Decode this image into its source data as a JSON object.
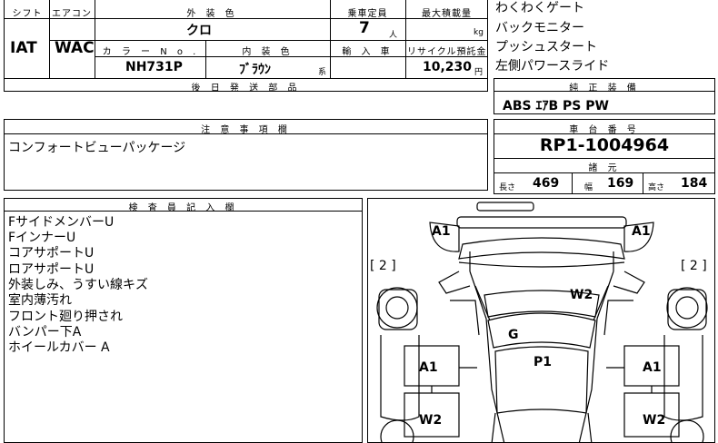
{
  "spec": {
    "shift_header": "シフト",
    "aircon_header": "エアコン",
    "shift": "IAT",
    "aircon": "WAC",
    "exterior_header": "外 装 色",
    "exterior": "クロ",
    "capacity_header": "乗車定員",
    "capacity": "7",
    "capacity_unit": "人",
    "loadcap_header": "最大積載量",
    "loadcap_unit": "kg",
    "colorno_header": "カ ラ ー N o .",
    "colorno": "NH731P",
    "interior_header": "内 装 色",
    "interior": "ﾌﾞﾗｳﾝ",
    "interior_suffix": "系",
    "import_header": "輸 入 車",
    "recycle_header": "リサイクル預託金",
    "recycle": "10,230",
    "recycle_unit": "円",
    "later_parts_header": "後 日 発 送 部 品"
  },
  "options": [
    "わくわくゲート",
    "バックモニター",
    "プッシュスタート",
    "左側パワースライド"
  ],
  "genuine": {
    "header": "純 正 装 備",
    "value": "ABS ｴｱB PS PW"
  },
  "caution": {
    "header": "注 意 事 項 欄",
    "text": "コンフォートビューパッケージ"
  },
  "chassis": {
    "header": "車 台 番 号",
    "value": "RP1-1004964"
  },
  "dims": {
    "header": "諸 元",
    "length_label": "長さ",
    "length": "469",
    "width_label": "幅",
    "width": "169",
    "height_label": "高さ",
    "height": "184"
  },
  "inspector": {
    "header": "検 査 員 記 入 欄",
    "lines": [
      "FサイドメンバーU",
      "FインナーU",
      "コアサポートU",
      "ロアサポートU",
      "外装しみ、うすい線キズ",
      "室内薄汚れ",
      "フロント廻り押され",
      "バンパー下A",
      "ホイールカバー A"
    ]
  },
  "diagram": {
    "marks": {
      "a1_front_left": "A1",
      "a1_front_right": "A1",
      "bracket_left": "[ 2 ]",
      "bracket_right": "[ 2 ]",
      "w2_hood": "W2",
      "g_glass": "G",
      "p1_roof": "P1",
      "a1_side_left": "A1",
      "a1_side_right": "A1",
      "w2_side_left": "W2",
      "w2_side_right": "W2"
    }
  }
}
